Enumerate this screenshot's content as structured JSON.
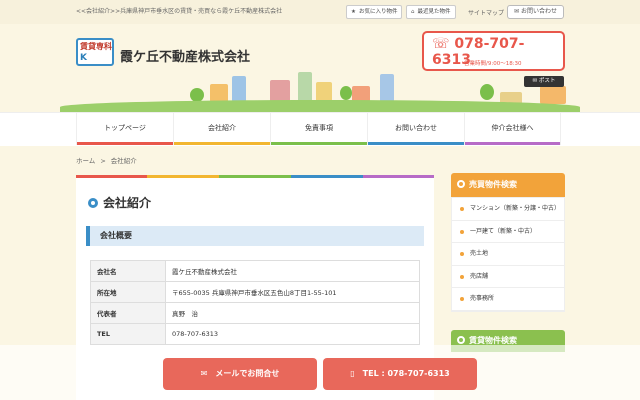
{
  "topbar": {
    "breadcrumb": "<<会社紹介>>兵庫県神戸市垂水区の賃貸・売買なら霞ケ丘不動産株式会社",
    "favorites_label": "お気に入り物件",
    "recent_label": "最近見た物件",
    "sitemap_label": "サイトマップ",
    "contact_label": "お問い合わせ"
  },
  "header": {
    "logo_line1": "賃貸専科",
    "logo_line2": "K",
    "company_name": "霞ケ丘不動産株式会社",
    "tel": "078-707-6313",
    "hours": "営業時間/9:00～18:30",
    "post_label": "ポスト"
  },
  "nav": {
    "items": [
      {
        "label": "トップページ",
        "color": "#e8574b"
      },
      {
        "label": "会社紹介",
        "color": "#f2b630"
      },
      {
        "label": "免責事項",
        "color": "#7bbf4b"
      },
      {
        "label": "お問い合わせ",
        "color": "#3a8ec7"
      },
      {
        "label": "仲介会社様へ",
        "color": "#b76bc7"
      }
    ]
  },
  "crumbs": {
    "home": "ホーム",
    "sep": ">",
    "current": "会社紹介"
  },
  "main": {
    "title": "会社紹介",
    "section_title": "会社概要",
    "rows": [
      {
        "key": "会社名",
        "value": "霞ケ丘不動産株式会社"
      },
      {
        "key": "所在地",
        "value": "〒655-0035 兵庫県神戸市垂水区五色山8丁目1-55-101"
      },
      {
        "key": "代表者",
        "value": "真野　治"
      },
      {
        "key": "TEL",
        "value": "078-707-6313"
      }
    ]
  },
  "sidebar": {
    "sale_title": "売買物件検索",
    "sale_items": [
      "マンション（新築・分譲・中古）",
      "一戸建て（新築・中古）",
      "売土地",
      "売店舗",
      "売事務所"
    ],
    "rent_title": "賃貸物件検索"
  },
  "cta": {
    "mail_label": "メールでお問合せ",
    "tel_label": "TEL : 078-707-6313"
  },
  "colors": {
    "accent_red": "#e8574b",
    "accent_blue": "#3a8ec7",
    "accent_orange": "#f2a33a",
    "accent_green": "#8bc04f"
  }
}
